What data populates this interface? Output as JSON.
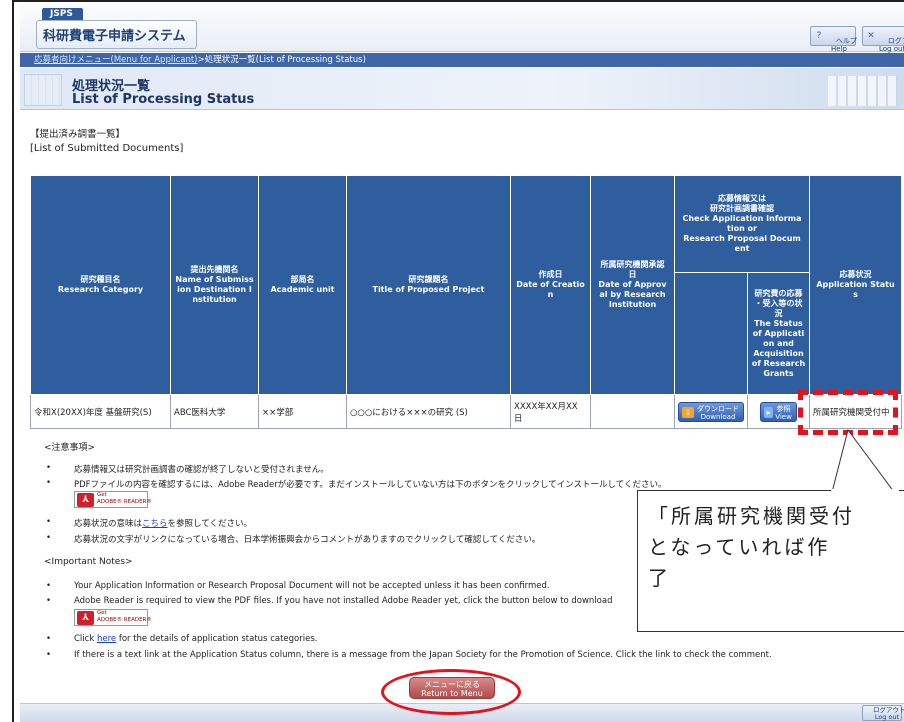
{
  "header": {
    "logo_top": "JSPS",
    "logo": "科研費電子申請システム",
    "help_label": "ヘルプ\nHelp",
    "logout_label": "ログアウト\nLog out"
  },
  "breadcrumb": {
    "link": "応募者向けメニュー(Menu for Applicant)",
    "separator": ">",
    "current": "処理状況一覧(List of Processing Status)"
  },
  "page_title": {
    "ja": "処理状況一覧",
    "en": "List of Processing Status"
  },
  "section": {
    "ja": "【提出済み調書一覧】",
    "en": "[List of Submitted Documents]"
  },
  "table": {
    "headers": [
      "研究種目名\nResearch Category",
      "提出先機関名\nName of Submiss\nion Destination I\nnstitution",
      "部局名\nAcademic unit",
      "研究課題名\nTitle of Proposed Project",
      "作成日\nDate of Creatio\nn",
      "所属研究機関承認\n日\nDate of Approv\nal by Research\nInstitution",
      "応募情報又は\n研究計画調書確認\nCheck Application Informa\ntion or\nResearch Proposal Docum\nent",
      "応募状況\nApplication Statu\ns"
    ],
    "subheader": "研究費の応募\n・受入等の状\n況\nThe Status\nof Applicati\non and\nAcquisition\nof Research\nGrants",
    "row": {
      "category": "令和X(20XX)年度 基盤研究(S)",
      "institution": "ABC医科大学",
      "unit": "××学部",
      "title": "○○○における×××の研究 (S)",
      "date": "XXXX年XX月XX\n日",
      "approval": "",
      "download_label": "ダウンロード\nDownload",
      "view_label": "参照\nView",
      "status": "所属研究機関受付中"
    }
  },
  "callout_text": "「所属研究機関受付\nとなっていれば作\n了",
  "notes_ja": {
    "heading": "<注意事項>",
    "item1": "応募情報又は研究計画調書の確認が終了しないと受付されません。",
    "item2": "PDFファイルの内容を確認するには、Adobe Readerが必要です。まだインストールしていない方は下のボタンをクリックしてインストールしてください。",
    "item3_pre": "応募状況の意味は",
    "item3_link": "こちら",
    "item3_post": "を参照してください。",
    "item4": "応募状況の文字がリンクになっている場合、日本学術振興会からコメントがありますのでクリックして確認してください。"
  },
  "notes_en": {
    "heading": "<Important Notes>",
    "item1": "Your Application Information or Research Proposal Document will not be accepted unless it has been confirmed.",
    "item2": "Adobe Reader is required to view the PDF files. If you have not installed Adobe Reader yet, click the button below to download",
    "item3_pre": "Click ",
    "item3_link": "here",
    "item3_post": " for the details of application status categories.",
    "item4": "If there is a text link at the Application Status column, there is a message from the Japan Society for the Promotion of Science. Click the link to check the comment."
  },
  "adobe_badge": "Get\nADOBE® READER®",
  "return_label": "メニューに戻る\nReturn to Menu",
  "footer_logout": "ログアウト\nLog out",
  "colors": {
    "accent": "#2f5e9e",
    "annotation": "#e5121a"
  }
}
